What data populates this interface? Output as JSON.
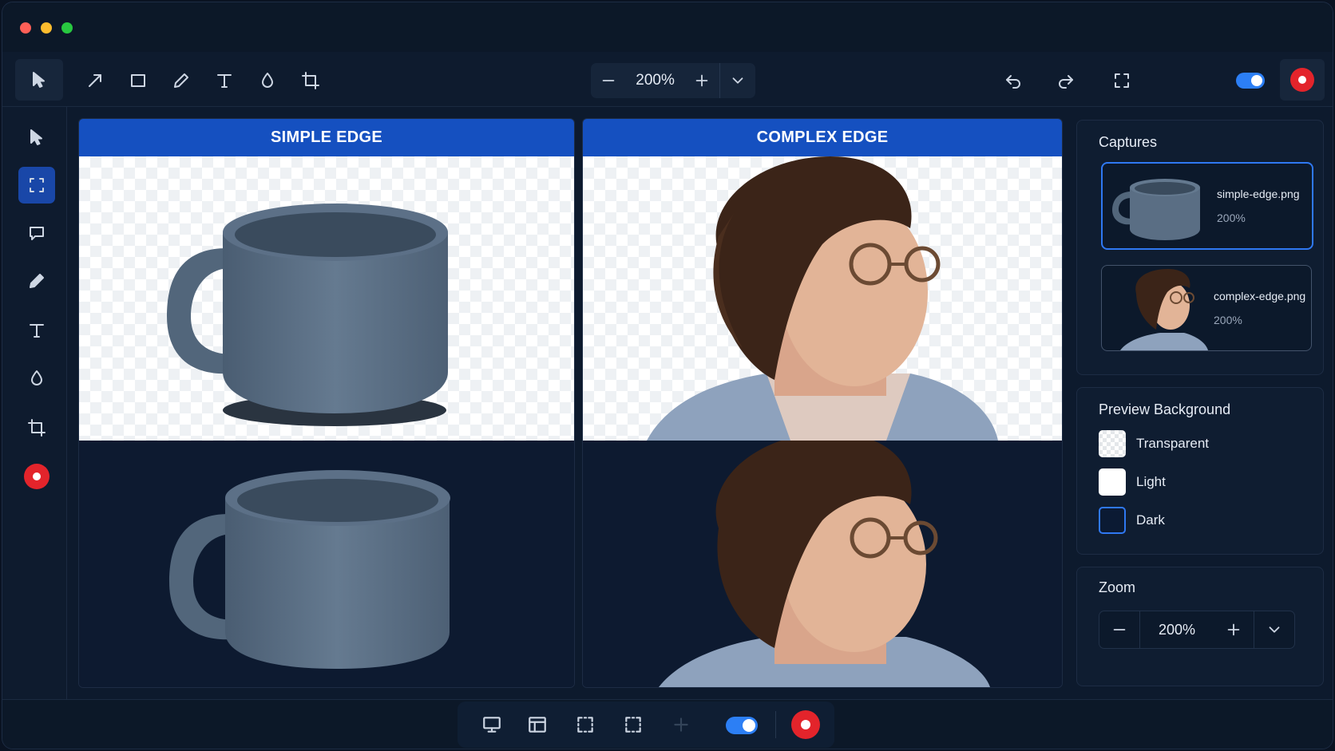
{
  "toolbar": {
    "zoom_value": "200%"
  },
  "panels": {
    "left_title": "SIMPLE EDGE",
    "right_title": "COMPLEX EDGE"
  },
  "captures": {
    "title": "Captures",
    "items": [
      {
        "name": "simple-edge.png",
        "zoom": "200%"
      },
      {
        "name": "complex-edge.png",
        "zoom": "200%"
      }
    ]
  },
  "preview_background": {
    "title": "Preview Background",
    "options": [
      {
        "label": "Transparent"
      },
      {
        "label": "Light"
      },
      {
        "label": "Dark"
      }
    ]
  },
  "zoom_panel": {
    "title": "Zoom",
    "value": "200%"
  },
  "colors": {
    "accent": "#1550c0",
    "toggle": "#2c7ff5",
    "record": "#e3242b"
  }
}
